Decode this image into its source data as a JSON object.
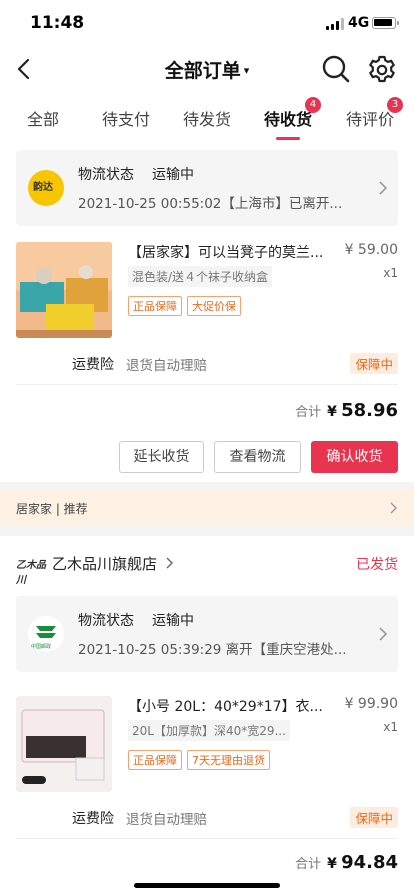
{
  "status_bar": {
    "time": "11:48",
    "network": "4G"
  },
  "nav": {
    "title": "全部订单",
    "caret": "▾"
  },
  "tabs": [
    {
      "label": "全部"
    },
    {
      "label": "待支付"
    },
    {
      "label": "待发货"
    },
    {
      "label": "待收货",
      "badge": "4"
    },
    {
      "label": "待评价",
      "badge": "3"
    }
  ],
  "order1": {
    "logistics": {
      "logo_text": "韵达",
      "label": "物流状态",
      "status": "运输中",
      "detail": "2021-10-25 00:55:02【上海市】已离开..."
    },
    "product": {
      "title": "【居家家】可以当凳子的莫兰...",
      "price": "¥ 59.00",
      "qty": "x1",
      "sku": "混色装/送４个袜子收纳盒",
      "tags": [
        "正品保障",
        "大促价保"
      ]
    },
    "insurance": {
      "label": "运费险",
      "desc": "退货自动理赔",
      "badge": "保障中"
    },
    "total": {
      "label": "合计",
      "currency": "¥",
      "amount": "58.96"
    },
    "buttons": {
      "extend": "延长收货",
      "logistics": "查看物流",
      "confirm": "确认收货"
    }
  },
  "recommend": {
    "text": "居家家 | 推荐"
  },
  "order2": {
    "store": {
      "logo_text": "乙木品川",
      "name": "乙木品川旗舰店",
      "status": "已发货"
    },
    "logistics": {
      "logo_text": "中国邮政",
      "label": "物流状态",
      "status": "运输中",
      "detail": "2021-10-25 05:39:29 离开【重庆空港处..."
    },
    "product": {
      "title": "【小号 20L：40*29*17】衣...",
      "price": "¥ 99.90",
      "qty": "x1",
      "sku": "20L【加厚款】深40*宽29...",
      "tags": [
        "正品保障",
        "7天无理由退货"
      ]
    },
    "insurance": {
      "label": "运费险",
      "desc": "退货自动理赔",
      "badge": "保障中"
    },
    "total": {
      "label": "合计",
      "currency": "¥",
      "amount": "94.84"
    }
  },
  "colors": {
    "accent": "#e8344e",
    "warning": "#e96a1a",
    "yunda": "#f7c600",
    "ems": "#1b8c3a"
  }
}
